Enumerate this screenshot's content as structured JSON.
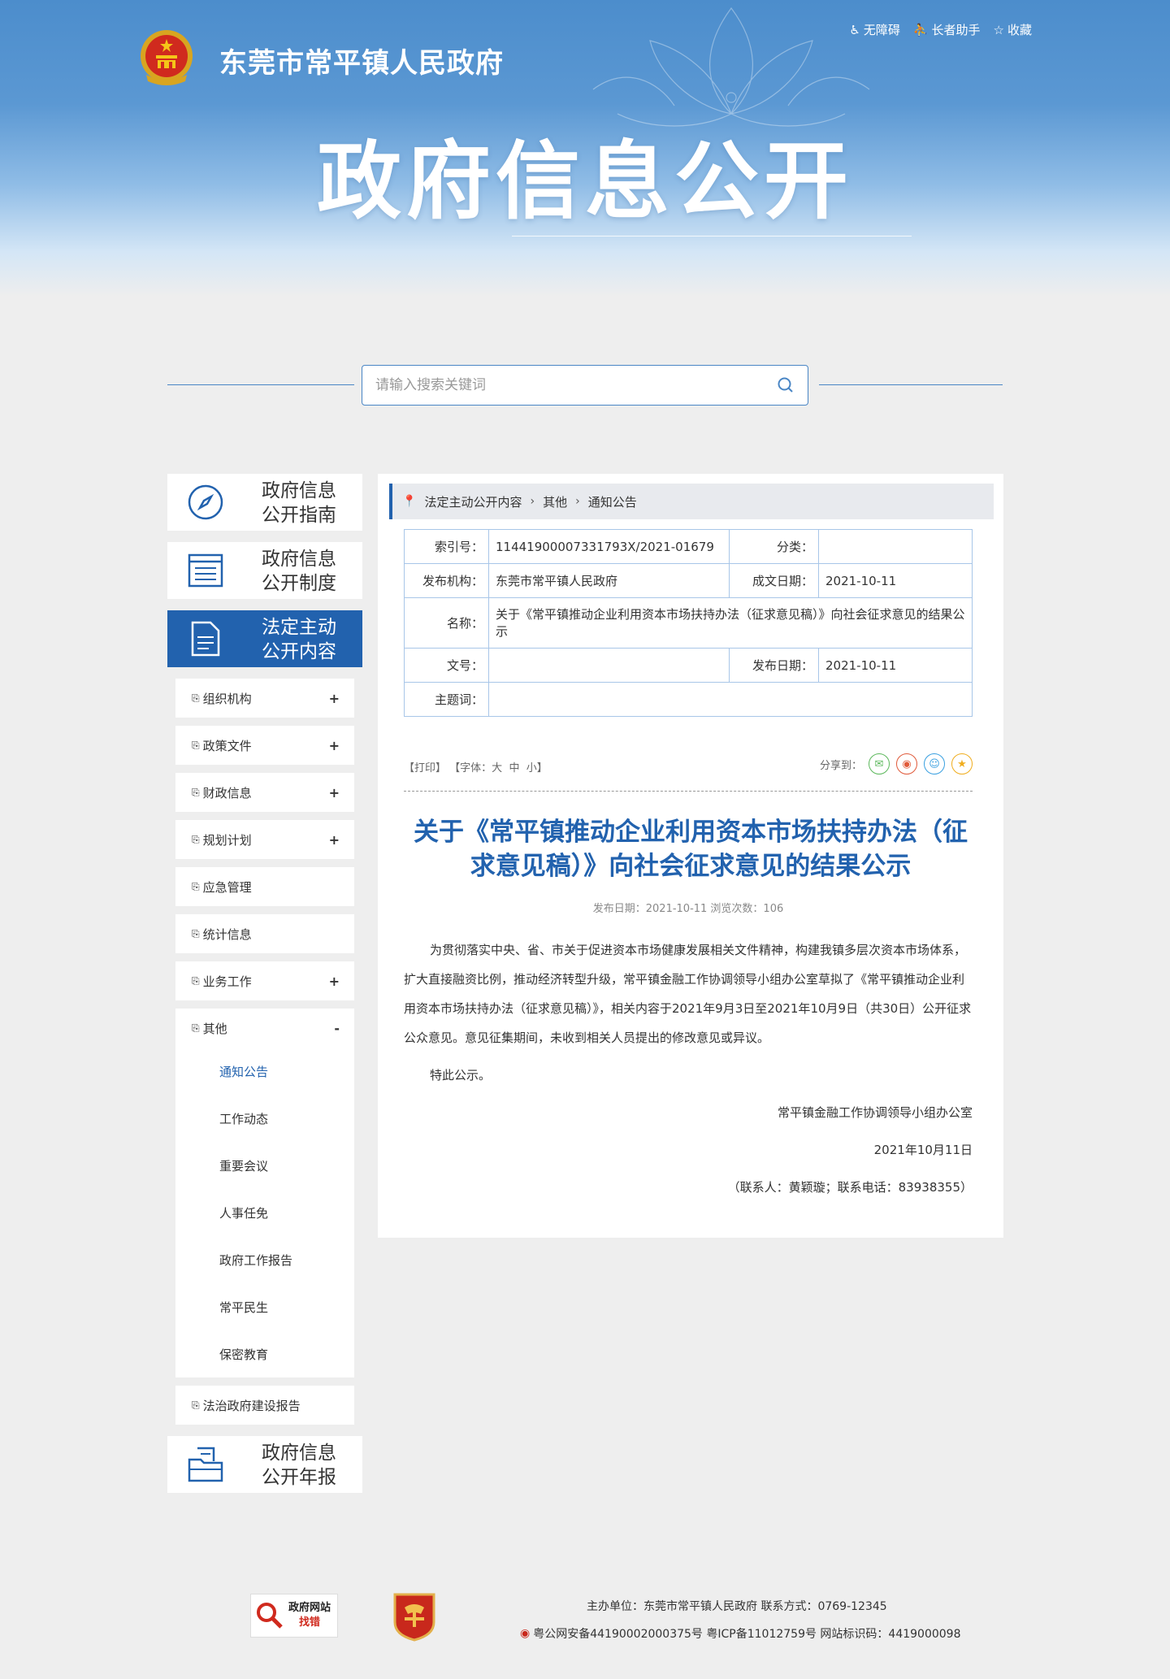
{
  "header": {
    "site_title": "东莞市常平镇人民政府",
    "big_title": "政府信息公开",
    "tools": [
      "无障碍",
      "长者助手",
      "收藏"
    ]
  },
  "search": {
    "placeholder": "请输入搜索关键词"
  },
  "sidebar": {
    "guide": "政府信息公开指南",
    "guide_l1": "政府信息",
    "guide_l2": "公开指南",
    "system_l1": "政府信息",
    "system_l2": "公开制度",
    "content_l1": "法定主动",
    "content_l2": "公开内容",
    "annual_l1": "政府信息",
    "annual_l2": "公开年报",
    "categories": [
      {
        "label": "组织机构",
        "toggle": "+"
      },
      {
        "label": "政策文件",
        "toggle": "+"
      },
      {
        "label": "财政信息",
        "toggle": "+"
      },
      {
        "label": "规划计划",
        "toggle": "+"
      },
      {
        "label": "应急管理",
        "toggle": ""
      },
      {
        "label": "统计信息",
        "toggle": ""
      },
      {
        "label": "业务工作",
        "toggle": "+"
      }
    ],
    "other": {
      "label": "其他",
      "toggle": "-"
    },
    "other_items": [
      "通知公告",
      "工作动态",
      "重要会议",
      "人事任免",
      "政府工作报告",
      "常平民生",
      "保密教育"
    ],
    "last": "法治政府建设报告"
  },
  "breadcrumb": [
    "法定主动公开内容",
    "其他",
    "通知公告"
  ],
  "meta": {
    "index_label": "索引号：",
    "index_value": "11441900007331793X/2021-01679",
    "category_label": "分类：",
    "category_value": "",
    "publisher_label": "发布机构：",
    "publisher_value": "东莞市常平镇人民政府",
    "created_label": "成文日期：",
    "created_value": "2021-10-11",
    "name_label": "名称：",
    "name_value": "关于《常平镇推动企业利用资本市场扶持办法（征求意见稿）》向社会征求意见的结果公示",
    "doc_label": "文号：",
    "doc_value": "",
    "pub_label": "发布日期：",
    "pub_value": "2021-10-11",
    "topic_label": "主题词：",
    "topic_value": ""
  },
  "article_tools": {
    "print": "【打印】",
    "font_prefix": "【字体：",
    "font_big": "大",
    "font_mid": "中",
    "font_small": "小",
    "font_suffix": "】",
    "share_label": "分享到："
  },
  "article": {
    "title": "关于《常平镇推动企业利用资本市场扶持办法（征求意见稿）》向社会征求意见的结果公示",
    "info": "发布日期：2021-10-11  浏览次数：106",
    "p1": "为贯彻落实中央、省、市关于促进资本市场健康发展相关文件精神，构建我镇多层次资本市场体系，扩大直接融资比例，推动经济转型升级，常平镇金融工作协调领导小组办公室草拟了《常平镇推动企业利用资本市场扶持办法（征求意见稿）》，相关内容于2021年9月3日至2021年10月9日（共30日）公开征求公众意见。意见征集期间，未收到相关人员提出的修改意见或异议。",
    "p2": "特此公示。",
    "signature": "常平镇金融工作协调领导小组办公室",
    "date": "2021年10月11日",
    "contact": "（联系人：黄颖璇；联系电话：83938355）"
  },
  "footer": {
    "jiucuo_l1": "政府网站",
    "jiucuo_l2": "找错",
    "line1": "主办单位：东莞市常平镇人民政府    联系方式：0769-12345",
    "line2": "粤公网安备44190002000375号 粤ICP备11012759号 网站标识码：4419000098"
  },
  "colors": {
    "primary": "#2262ae",
    "banner": "#4c8dcc",
    "border": "#a8c6e8"
  }
}
